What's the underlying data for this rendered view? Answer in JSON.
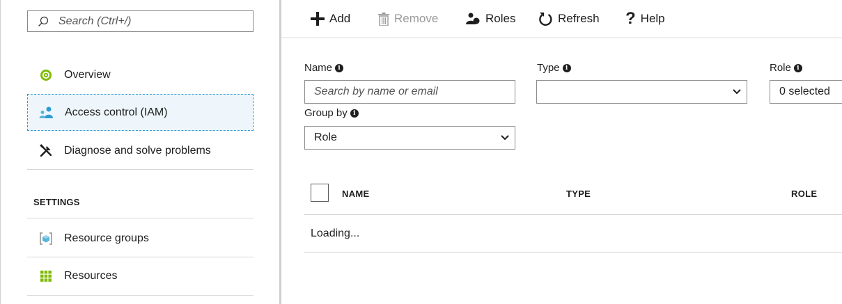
{
  "sidebar": {
    "search_placeholder": "Search (Ctrl+/)",
    "items": [
      {
        "label": "Overview",
        "icon": "overview-icon"
      },
      {
        "label": "Access control (IAM)",
        "icon": "iam-icon",
        "selected": true
      },
      {
        "label": "Diagnose and solve problems",
        "icon": "wrench-icon"
      }
    ],
    "settings_header": "SETTINGS",
    "settings_items": [
      {
        "label": "Resource groups",
        "icon": "resource-groups-icon"
      },
      {
        "label": "Resources",
        "icon": "resources-icon"
      }
    ]
  },
  "toolbar": {
    "add_label": "Add",
    "remove_label": "Remove",
    "roles_label": "Roles",
    "refresh_label": "Refresh",
    "help_label": "Help"
  },
  "filters": {
    "name_label": "Name",
    "name_placeholder": "Search by name or email",
    "type_label": "Type",
    "type_value": "",
    "role_label": "Role",
    "role_value": "0 selected",
    "group_by_label": "Group by",
    "group_by_value": "Role"
  },
  "table": {
    "columns": [
      "NAME",
      "TYPE",
      "ROLE"
    ],
    "status_text": "Loading..."
  },
  "colors": {
    "accent": "#2a9bd4",
    "overview_green": "#7fba00",
    "iam_blue": "#2a9bd4",
    "resources_green": "#7fba00"
  }
}
